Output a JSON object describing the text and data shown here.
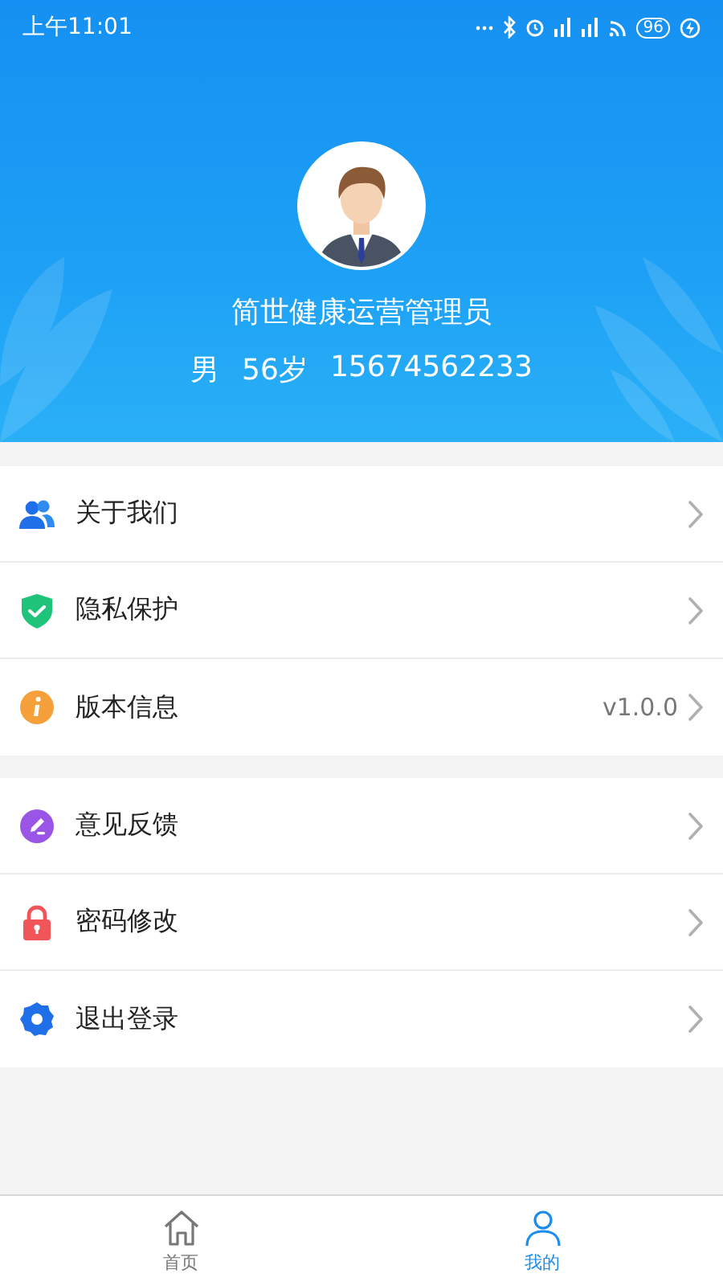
{
  "status_bar": {
    "time": "上午11:01",
    "battery": "96"
  },
  "profile": {
    "name": "简世健康运营管理员",
    "gender": "男",
    "age": "56岁",
    "phone": "15674562233"
  },
  "menu_groups": [
    [
      {
        "kind": "people",
        "label": "关于我们"
      },
      {
        "kind": "shield",
        "label": "隐私保护"
      },
      {
        "kind": "info",
        "label": "版本信息",
        "value": "v1.0.0"
      }
    ],
    [
      {
        "kind": "edit",
        "label": "意见反馈"
      },
      {
        "kind": "lock",
        "label": "密码修改"
      },
      {
        "kind": "gear",
        "label": "退出登录"
      }
    ]
  ],
  "tab_bar": [
    {
      "kind": "home",
      "label": "首页",
      "selected": false
    },
    {
      "kind": "person",
      "label": "我的",
      "selected": true
    }
  ]
}
